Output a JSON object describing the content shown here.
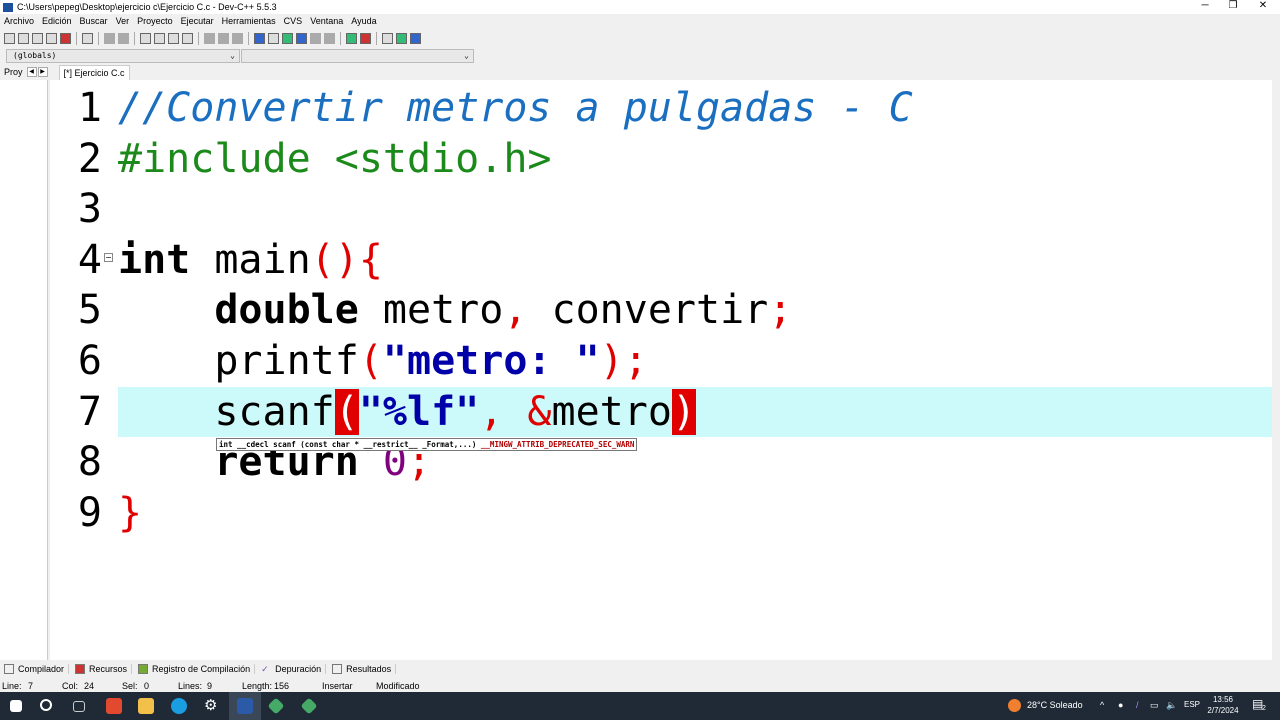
{
  "window": {
    "title": "C:\\Users\\pepeg\\Desktop\\ejercicio  c\\Ejercicio C.c - Dev-C++ 5.5.3",
    "minimize": "─",
    "maximize": "❐",
    "close": "✕"
  },
  "menu": [
    "Archivo",
    "Edición",
    "Buscar",
    "Ver",
    "Proyecto",
    "Ejecutar",
    "Herramientas",
    "CVS",
    "Ventana",
    "Ayuda"
  ],
  "combos": {
    "scope": "(globals)",
    "member": ""
  },
  "tabs": {
    "project": "Proy",
    "file_tab": "[*] Ejercicio C.c"
  },
  "editor": {
    "active_line": 7,
    "lines": [
      {
        "n": "1",
        "tokens": [
          {
            "t": "//Convertir metros a pulgadas - C",
            "c": "comment"
          }
        ]
      },
      {
        "n": "2",
        "tokens": [
          {
            "t": "#include <stdio.h>",
            "c": "pre"
          }
        ]
      },
      {
        "n": "3",
        "tokens": []
      },
      {
        "n": "4",
        "fold": "−",
        "tokens": [
          {
            "t": "int",
            "c": "kw"
          },
          {
            "t": " main",
            "c": "id"
          },
          {
            "t": "(){",
            "c": "sym"
          }
        ]
      },
      {
        "n": "5",
        "tokens": [
          {
            "t": "    ",
            "c": "id"
          },
          {
            "t": "double",
            "c": "kw"
          },
          {
            "t": " metro",
            "c": "id"
          },
          {
            "t": ",",
            "c": "sym"
          },
          {
            "t": " convertir",
            "c": "id"
          },
          {
            "t": ";",
            "c": "sym"
          }
        ]
      },
      {
        "n": "6",
        "tokens": [
          {
            "t": "    printf",
            "c": "id"
          },
          {
            "t": "(",
            "c": "sym"
          },
          {
            "t": "\"metro: \"",
            "c": "str"
          },
          {
            "t": ");",
            "c": "sym"
          }
        ]
      },
      {
        "n": "7",
        "tokens": [
          {
            "t": "    scanf",
            "c": "id"
          },
          {
            "t": "(",
            "c": "match"
          },
          {
            "t": "\"%lf\"",
            "c": "str"
          },
          {
            "t": ", &",
            "c": "sym"
          },
          {
            "t": "metro",
            "c": "id"
          },
          {
            "t": ")",
            "c": "match"
          }
        ]
      },
      {
        "n": "8",
        "tokens": [
          {
            "t": "    ",
            "c": "id"
          },
          {
            "t": "return",
            "c": "kw"
          },
          {
            "t": " ",
            "c": "id"
          },
          {
            "t": "0",
            "c": "num"
          },
          {
            "t": ";",
            "c": "sym"
          }
        ]
      },
      {
        "n": "9",
        "tokens": [
          {
            "t": "}",
            "c": "sym"
          }
        ]
      }
    ]
  },
  "tooltip": {
    "signature": "int __cdecl scanf (const char * __restrict__ _Format,...) ",
    "warn": "__MINGW_ATTRIB_DEPRECATED_SEC_WARN"
  },
  "bottom_tabs": [
    "Compilador",
    "Recursos",
    "Registro de Compilación",
    "Depuración",
    "Resultados"
  ],
  "status": {
    "line_label": "Line:",
    "line": "7",
    "col_label": "Col:",
    "col": "24",
    "sel_label": "Sel:",
    "sel": "0",
    "lines_label": "Lines:",
    "lines": "9",
    "length_label": "Length:",
    "length": "156",
    "mode": "Insertar",
    "state": "Modificado"
  },
  "taskbar": {
    "weather": "28°C  Soleado",
    "lang": "ESP",
    "time": "13:56",
    "date": "2/7/2024",
    "notif_count": "2"
  }
}
